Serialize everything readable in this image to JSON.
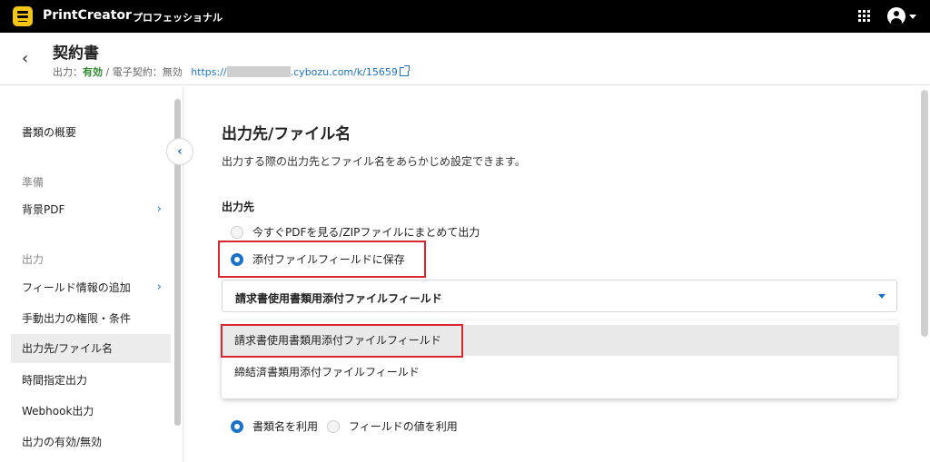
{
  "topbar": {
    "app_name": "PrintCreator",
    "edition": "プロフェッショナル"
  },
  "header": {
    "title": "契約書",
    "output_label": "出力：",
    "output_status": "有効",
    "separator": " / ",
    "esign_label": "電子契約：",
    "esign_status": "無効",
    "url_prefix": "https://",
    "url_suffix": ".cybozu.com/k/15659"
  },
  "sidebar": {
    "overview": "書類の概要",
    "section_prep": "準備",
    "background_pdf": "背景PDF",
    "section_output": "出力",
    "field_info": "フィールド情報の追加",
    "manual_output": "手動出力の権限・条件",
    "destination": "出力先/ファイル名",
    "scheduled": "時間指定出力",
    "webhook": "Webhook出力",
    "enable_disable": "出力の有効/無効"
  },
  "main": {
    "title": "出力先/ファイル名",
    "description": "出力する際の出力先とファイル名をあらかじめ設定できます。",
    "destination_label": "出力先",
    "option_view_pdf": "今すぐPDFを見る/ZIPファイルにまとめて出力",
    "option_save_attachment": "添付ファイルフィールドに保存",
    "select_value": "請求書使用書類用添付ファイルフィールド",
    "dropdown_options": [
      "請求書使用書類用添付ファイルフィールド",
      "締結済書類用添付ファイルフィールド"
    ],
    "filename_use_doc": "書類名を利用",
    "filename_use_field": "フィールドの値を利用"
  },
  "colors": {
    "accent": "#1a73c8",
    "highlight": "#d9262c",
    "status_ok": "#2e8b2e"
  }
}
